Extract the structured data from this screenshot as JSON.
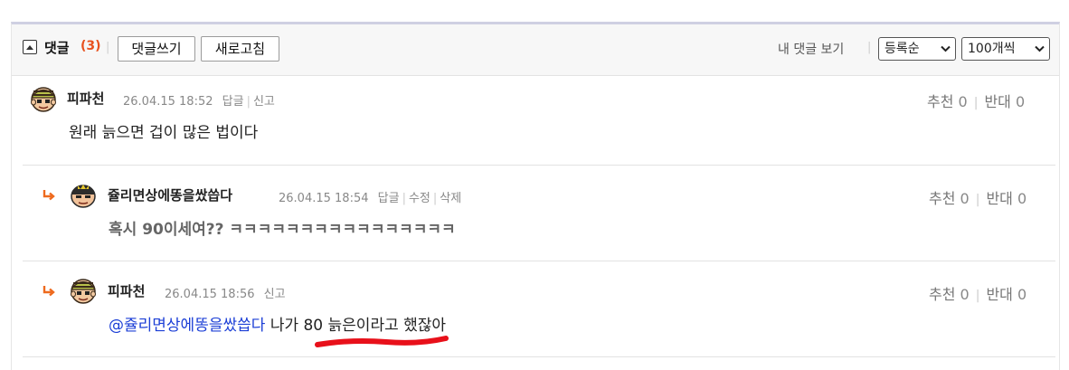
{
  "header": {
    "title": "댓글",
    "count": "(3)",
    "write_label": "댓글쓰기",
    "refresh_label": "새로고침",
    "my_comments_label": "내 댓글 보기",
    "sort_selected": "등록순",
    "per_page_selected": "100개씩",
    "separator": "|"
  },
  "comments": [
    {
      "nickname": "피파천",
      "date": "26.04.15 18:52",
      "actions": [
        "답글",
        "신고"
      ],
      "recommend_label": "추천",
      "recommend_count": "0",
      "oppose_label": "반대",
      "oppose_count": "0",
      "text": "원래 늙으면 겁이 많은 법이다"
    },
    {
      "nickname": "쥴리면상에똥을쌌씁다",
      "date": "26.04.15 18:54",
      "actions": [
        "답글",
        "수정",
        "삭제"
      ],
      "recommend_label": "추천",
      "recommend_count": "0",
      "oppose_label": "반대",
      "oppose_count": "0",
      "text": "혹시 90이세여?? ㅋㅋㅋㅋㅋㅋㅋㅋㅋㅋㅋㅋㅋㅋㅋㅋ"
    },
    {
      "nickname": "피파천",
      "date": "26.04.15 18:56",
      "actions": [
        "신고"
      ],
      "recommend_label": "추천",
      "recommend_count": "0",
      "oppose_label": "반대",
      "oppose_count": "0",
      "mention": "@쥴리면상에똥을쌌씁다",
      "text": "나가 80 늙은이라고 했잖아"
    }
  ],
  "colors": {
    "accent_count": "#e8511e",
    "mention": "#1c3fd6",
    "reply_arrow": "#ee6a1e",
    "highlight_underline": "#e8101a"
  }
}
